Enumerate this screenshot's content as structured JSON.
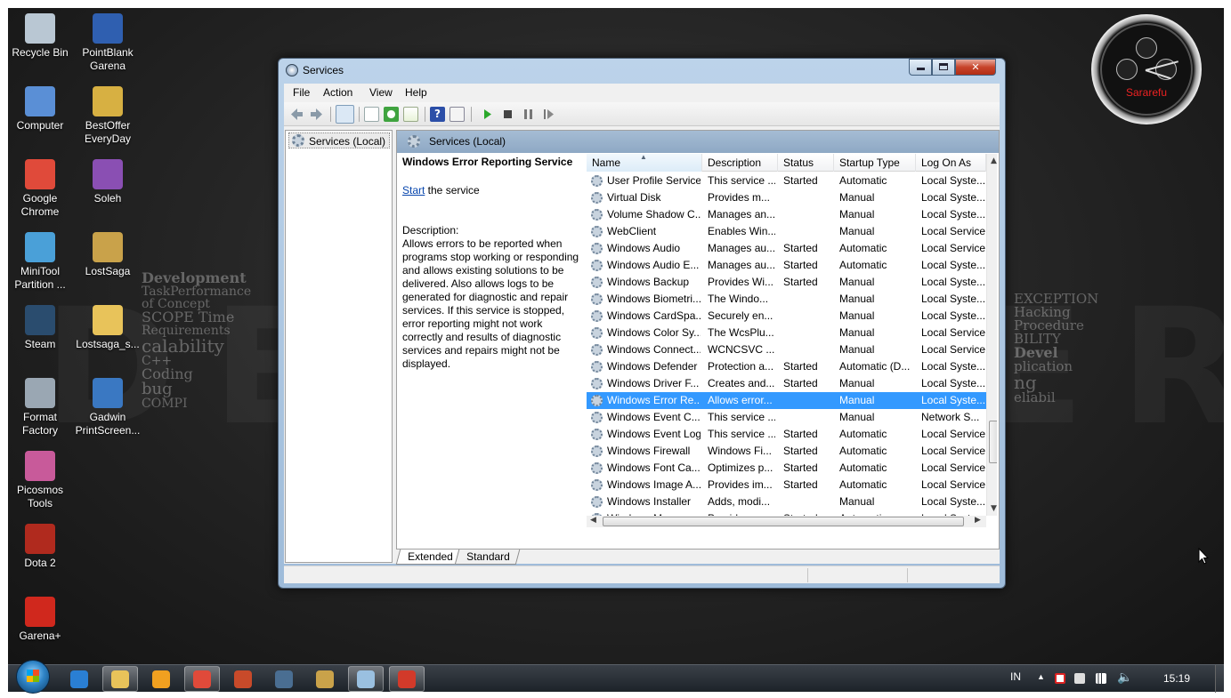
{
  "desktop": {
    "icons": [
      {
        "label": "Recycle Bin",
        "icon": "recycle-bin-icon",
        "color": "#b9c7d3"
      },
      {
        "label": "PointBlank Garena",
        "icon": "pointblank-icon",
        "color": "#2f5fb0"
      },
      {
        "label": "Computer",
        "icon": "computer-icon",
        "color": "#5a8fd6"
      },
      {
        "label": "BestOffer EveryDay",
        "icon": "gift-icon",
        "color": "#d7b042"
      },
      {
        "label": "Google Chrome",
        "icon": "chrome-icon",
        "color": "#e04a3a"
      },
      {
        "label": "Soleh",
        "icon": "archive-icon",
        "color": "#8a4fb3"
      },
      {
        "label": "MiniTool Partition ...",
        "icon": "minitool-icon",
        "color": "#4aa0d8"
      },
      {
        "label": "LostSaga",
        "icon": "lostsaga-icon",
        "color": "#c9a24a"
      },
      {
        "label": "Steam",
        "icon": "steam-icon",
        "color": "#2a4c6e"
      },
      {
        "label": "Lostsaga_s...",
        "icon": "folder-icon",
        "color": "#e8c35a"
      },
      {
        "label": "Format Factory",
        "icon": "format-factory-icon",
        "color": "#9aa7b3"
      },
      {
        "label": "Gadwin PrintScreen...",
        "icon": "gadwin-icon",
        "color": "#3a78c2"
      },
      {
        "label": "Picosmos Tools",
        "icon": "picosmos-icon",
        "color": "#c85a9a"
      },
      {
        "label": "Dota 2",
        "icon": "dota-icon",
        "color": "#b02a1e"
      },
      {
        "label": "Garena+",
        "icon": "garena-icon",
        "color": "#d0281d"
      }
    ],
    "clock_label": "Sararefu"
  },
  "window": {
    "title": "Services",
    "menu": [
      "File",
      "Action",
      "View",
      "Help"
    ],
    "tree_node": "Services (Local)",
    "pane_header": "Services (Local)",
    "description": {
      "service_name": "Windows Error Reporting Service",
      "start_link": "Start",
      "start_suffix": " the service",
      "label": "Description:",
      "text": "Allows errors to be reported when programs stop working or responding and allows existing solutions to be delivered. Also allows logs to be generated for diagnostic and repair services. If this service is stopped, error reporting might not work correctly and results of diagnostic services and repairs might not be displayed."
    },
    "columns": [
      "Name",
      "Description",
      "Status",
      "Startup Type",
      "Log On As"
    ],
    "rows": [
      {
        "name": "User Profile Service",
        "description": "This service ...",
        "status": "Started",
        "startup": "Automatic",
        "logon": "Local Syste..."
      },
      {
        "name": "Virtual Disk",
        "description": "Provides m...",
        "status": "",
        "startup": "Manual",
        "logon": "Local Syste..."
      },
      {
        "name": "Volume Shadow C...",
        "description": "Manages an...",
        "status": "",
        "startup": "Manual",
        "logon": "Local Syste..."
      },
      {
        "name": "WebClient",
        "description": "Enables Win...",
        "status": "",
        "startup": "Manual",
        "logon": "Local Service"
      },
      {
        "name": "Windows Audio",
        "description": "Manages au...",
        "status": "Started",
        "startup": "Automatic",
        "logon": "Local Service"
      },
      {
        "name": "Windows Audio E...",
        "description": "Manages au...",
        "status": "Started",
        "startup": "Automatic",
        "logon": "Local Syste..."
      },
      {
        "name": "Windows Backup",
        "description": "Provides Wi...",
        "status": "Started",
        "startup": "Manual",
        "logon": "Local Syste..."
      },
      {
        "name": "Windows Biometri...",
        "description": "The Windo...",
        "status": "",
        "startup": "Manual",
        "logon": "Local Syste..."
      },
      {
        "name": "Windows CardSpa...",
        "description": "Securely en...",
        "status": "",
        "startup": "Manual",
        "logon": "Local Syste..."
      },
      {
        "name": "Windows Color Sy...",
        "description": "The WcsPlu...",
        "status": "",
        "startup": "Manual",
        "logon": "Local Service"
      },
      {
        "name": "Windows Connect...",
        "description": "WCNCSVC ...",
        "status": "",
        "startup": "Manual",
        "logon": "Local Service"
      },
      {
        "name": "Windows Defender",
        "description": "Protection a...",
        "status": "Started",
        "startup": "Automatic (D...",
        "logon": "Local Syste..."
      },
      {
        "name": "Windows Driver F...",
        "description": "Creates and...",
        "status": "Started",
        "startup": "Manual",
        "logon": "Local Syste..."
      },
      {
        "name": "Windows Error Re...",
        "description": "Allows error...",
        "status": "",
        "startup": "Manual",
        "logon": "Local Syste..."
      },
      {
        "name": "Windows Event C...",
        "description": "This service ...",
        "status": "",
        "startup": "Manual",
        "logon": "Network S..."
      },
      {
        "name": "Windows Event Log",
        "description": "This service ...",
        "status": "Started",
        "startup": "Automatic",
        "logon": "Local Service"
      },
      {
        "name": "Windows Firewall",
        "description": "Windows Fi...",
        "status": "Started",
        "startup": "Automatic",
        "logon": "Local Service"
      },
      {
        "name": "Windows Font Ca...",
        "description": "Optimizes p...",
        "status": "Started",
        "startup": "Automatic",
        "logon": "Local Service"
      },
      {
        "name": "Windows Image A...",
        "description": "Provides im...",
        "status": "Started",
        "startup": "Automatic",
        "logon": "Local Service"
      },
      {
        "name": "Windows Installer",
        "description": "Adds, modi...",
        "status": "",
        "startup": "Manual",
        "logon": "Local Syste..."
      },
      {
        "name": "Windows Manage...",
        "description": "Provides a c...",
        "status": "Started",
        "startup": "Automatic",
        "logon": "Local Syste..."
      }
    ],
    "selected_row": "Windows Error Re...",
    "tabs": [
      "Extended",
      "Standard"
    ],
    "active_tab": "Extended"
  },
  "taskbar": {
    "buttons": [
      {
        "icon": "internet-explorer-icon",
        "color": "#2a7fd4",
        "open": false
      },
      {
        "icon": "explorer-folder-icon",
        "color": "#e8c35a",
        "open": true
      },
      {
        "icon": "media-player-icon",
        "color": "#f0a020",
        "open": false
      },
      {
        "icon": "chrome-icon",
        "color": "#e04a3a",
        "open": true
      },
      {
        "icon": "gift-icon",
        "color": "#c84a2a",
        "open": false
      },
      {
        "icon": "steam-icon",
        "color": "#4a6e92",
        "open": false
      },
      {
        "icon": "lostsaga-icon",
        "color": "#c9a24a",
        "open": false
      },
      {
        "icon": "notepad-icon",
        "color": "#9ac0e0",
        "open": true
      },
      {
        "icon": "services-icon",
        "color": "#d23a2a",
        "open": true
      }
    ],
    "language": "IN",
    "time": "15:19"
  },
  "colors": {
    "selection": "#3399ff",
    "link": "#0645ad"
  }
}
